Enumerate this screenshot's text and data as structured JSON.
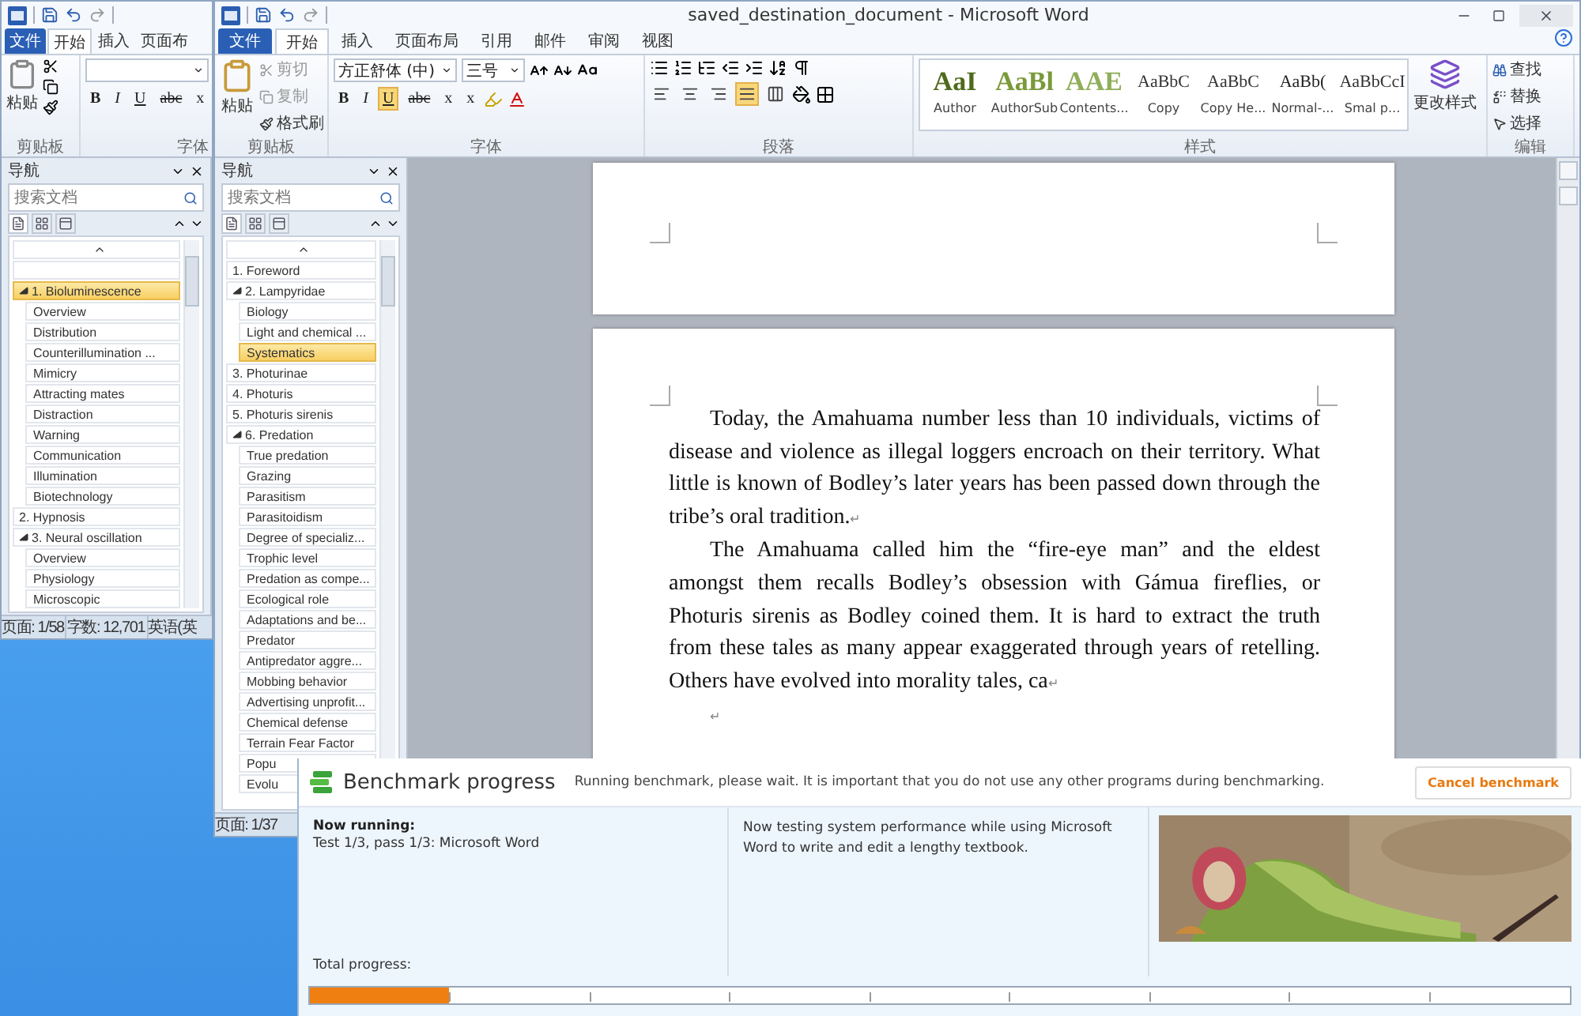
{
  "back_window": {
    "tabs": [
      {
        "label": "文件",
        "selected": false,
        "kind": "file"
      },
      {
        "label": "开始",
        "selected": true,
        "kind": "tab"
      },
      {
        "label": "插入",
        "selected": false,
        "kind": "tab"
      },
      {
        "label": "页面布",
        "selected": false,
        "kind": "tab"
      }
    ],
    "ribbon": {
      "paste": "粘贴",
      "clipboard_label": "剪贴板",
      "font_label": "字体",
      "format_buttons": [
        {
          "label": "B",
          "kind": "bold"
        },
        {
          "label": "I",
          "kind": "italic"
        },
        {
          "label": "U",
          "kind": "underline"
        },
        {
          "label": "abc",
          "kind": "strike"
        },
        {
          "label": "x",
          "kind": "sub"
        }
      ]
    },
    "navigation": {
      "title": "导航",
      "search_placeholder": "搜索文档",
      "items": [
        {
          "kind": "collapse",
          "selected": false
        },
        {
          "kind": "blank",
          "selected": false
        },
        {
          "label": "1. Bioluminescence",
          "kind": "heading",
          "selected": true,
          "expanded": true,
          "children": [
            {
              "label": "Overview",
              "kind": "heading",
              "selected": false
            },
            {
              "label": "Distribution",
              "kind": "heading",
              "selected": false
            },
            {
              "label": "Counterillumination ...",
              "kind": "heading",
              "selected": false
            },
            {
              "label": "Mimicry",
              "kind": "heading",
              "selected": false
            },
            {
              "label": "Attracting mates",
              "kind": "heading",
              "selected": false
            },
            {
              "label": "Distraction",
              "kind": "heading",
              "selected": false
            },
            {
              "label": "Warning",
              "kind": "heading",
              "selected": false
            },
            {
              "label": "Communication",
              "kind": "heading",
              "selected": false
            },
            {
              "label": "Illumination",
              "kind": "heading",
              "selected": false
            },
            {
              "label": "Biotechnology",
              "kind": "heading",
              "selected": false
            }
          ]
        },
        {
          "label": "2. Hypnosis",
          "kind": "heading",
          "selected": false,
          "expanded": false
        },
        {
          "label": "3. Neural oscillation",
          "kind": "heading",
          "selected": false,
          "expanded": true,
          "children": [
            {
              "label": "Overview",
              "kind": "heading",
              "selected": false
            },
            {
              "label": "Physiology",
              "kind": "heading",
              "selected": false
            },
            {
              "label": "Microscopic",
              "kind": "heading",
              "selected": false
            }
          ]
        }
      ]
    },
    "status_bar": [
      "页面: 1/58",
      "字数: 12,701",
      "英语(英"
    ]
  },
  "front_window": {
    "title": "saved_destination_document - Microsoft Word",
    "tabs": [
      {
        "label": "文件",
        "selected": false,
        "kind": "file"
      },
      {
        "label": "开始",
        "selected": true,
        "kind": "tab"
      },
      {
        "label": "插入",
        "selected": false,
        "kind": "tab"
      },
      {
        "label": "页面布局",
        "selected": false,
        "kind": "tab"
      },
      {
        "label": "引用",
        "selected": false,
        "kind": "tab"
      },
      {
        "label": "邮件",
        "selected": false,
        "kind": "tab"
      },
      {
        "label": "审阅",
        "selected": false,
        "kind": "tab"
      },
      {
        "label": "视图",
        "selected": false,
        "kind": "tab"
      }
    ],
    "ribbon": {
      "clipboard": {
        "paste": "粘贴",
        "cut": "剪切",
        "copy": "复制",
        "format_painter": "格式刷",
        "label": "剪贴板"
      },
      "font": {
        "font_name": "方正舒体 (中)",
        "font_size": "三号",
        "label": "字体",
        "format_buttons": [
          {
            "label": "B",
            "kind": "bold",
            "selected": false
          },
          {
            "label": "I",
            "kind": "italic",
            "selected": false
          },
          {
            "label": "U",
            "kind": "underline",
            "selected": true
          },
          {
            "label": "abc",
            "kind": "strike",
            "selected": false
          },
          {
            "label": "x",
            "kind": "sub",
            "selected": false
          },
          {
            "label": "x",
            "kind": "sup",
            "selected": false
          }
        ]
      },
      "paragraph": {
        "label": "段落",
        "alignments": [
          {
            "kind": "left",
            "selected": false
          },
          {
            "kind": "center",
            "selected": false
          },
          {
            "kind": "right",
            "selected": false
          },
          {
            "kind": "justify",
            "selected": true
          },
          {
            "kind": "distribute",
            "selected": false
          }
        ]
      },
      "styles": {
        "label": "样式",
        "items": [
          {
            "sample": "AaI",
            "name": "Author",
            "color": "#4f6a1c"
          },
          {
            "sample": "AaBl",
            "name": "AuthorSub",
            "color": "#7a9a3a"
          },
          {
            "sample": "AAE",
            "name": "Contents...",
            "color": "#8fae5a"
          },
          {
            "sample": "AaBbC",
            "name": "Copy",
            "color": "#333333"
          },
          {
            "sample": "AaBbC",
            "name": "Copy He...",
            "color": "#333333"
          },
          {
            "sample": "AaBb(",
            "name": "Normal-...",
            "color": "#222222"
          },
          {
            "sample": "AaBbCcI",
            "name": "Smal p...",
            "color": "#333333"
          }
        ],
        "change_styles": "更改样式"
      },
      "editing": {
        "label": "编辑",
        "find": "查找",
        "replace": "替换",
        "select": "选择"
      }
    },
    "navigation": {
      "title": "导航",
      "search_placeholder": "搜索文档",
      "items": [
        {
          "kind": "collapse",
          "selected": false
        },
        {
          "label": "1. Foreword",
          "kind": "heading",
          "selected": false,
          "expanded": false
        },
        {
          "label": "2. Lampyridae",
          "kind": "heading",
          "selected": false,
          "expanded": true,
          "children": [
            {
              "label": "Biology",
              "kind": "heading",
              "selected": false
            },
            {
              "label": "Light and chemical ...",
              "kind": "heading",
              "selected": false
            },
            {
              "label": "Systematics",
              "kind": "heading",
              "selected": true
            }
          ]
        },
        {
          "label": "3. Photurinae",
          "kind": "heading",
          "selected": false,
          "expanded": false
        },
        {
          "label": "4. Photuris",
          "kind": "heading",
          "selected": false,
          "expanded": false
        },
        {
          "label": "5. Photuris sirenis",
          "kind": "heading",
          "selected": false,
          "expanded": false
        },
        {
          "label": "6. Predation",
          "kind": "heading",
          "selected": false,
          "expanded": true,
          "children": [
            {
              "label": "True predation",
              "kind": "heading",
              "selected": false
            },
            {
              "label": "Grazing",
              "kind": "heading",
              "selected": false
            },
            {
              "label": "Parasitism",
              "kind": "heading",
              "selected": false
            },
            {
              "label": "Parasitoidism",
              "kind": "heading",
              "selected": false
            },
            {
              "label": "Degree of specializ...",
              "kind": "heading",
              "selected": false
            },
            {
              "label": "Trophic level",
              "kind": "heading",
              "selected": false
            },
            {
              "label": "Predation as compe...",
              "kind": "heading",
              "selected": false
            },
            {
              "label": "Ecological role",
              "kind": "heading",
              "selected": false
            },
            {
              "label": "Adaptations and be...",
              "kind": "heading",
              "selected": false
            },
            {
              "label": "Predator",
              "kind": "heading",
              "selected": false
            },
            {
              "label": "Antipredator aggre...",
              "kind": "heading",
              "selected": false
            },
            {
              "label": "Mobbing behavior",
              "kind": "heading",
              "selected": false
            },
            {
              "label": "Advertising unprofit...",
              "kind": "heading",
              "selected": false
            },
            {
              "label": "Chemical defense",
              "kind": "heading",
              "selected": false
            },
            {
              "label": "Terrain Fear Factor",
              "kind": "heading",
              "selected": false
            },
            {
              "label": "Popu",
              "kind": "heading",
              "selected": false
            },
            {
              "label": "Evolu",
              "kind": "heading",
              "selected": false
            }
          ]
        }
      ]
    },
    "document": {
      "paragraphs": [
        {
          "text": "Today, the Amahuama number less than 10 individuals, victims of disease and violence as illegal loggers encroach on their territory. What little is known of Bodley’s later years has been passed down through the tribe’s oral tradition.",
          "mark": "↵"
        },
        {
          "text": "The Amahuama called him the “fire-eye man” and the eldest amongst them recalls Bodley’s obsession with Gámua fireflies, or Photuris sirenis as Bodley coined them. It is hard to extract the truth from these tales as many appear exaggerated through years of retelling. Others have evolved into morality tales, ca",
          "mark": "↵"
        },
        {
          "mark": "↵"
        }
      ]
    },
    "status_bar": [
      "页面: 1/37"
    ]
  },
  "benchmark": {
    "title": "Benchmark progress",
    "message": "Running benchmark, please wait. It is important that you do not use any other programs during benchmarking.",
    "cancel_button": "Cancel benchmark",
    "now_running_label": "Now running:",
    "now_running": "Test 1/3, pass 1/3: Microsoft Word",
    "description": "Now testing system performance while using Microsoft Word to write and edit a lengthy textbook.",
    "total_progress_label": "Total progress:",
    "total_progress": {
      "level": 0.11
    }
  }
}
